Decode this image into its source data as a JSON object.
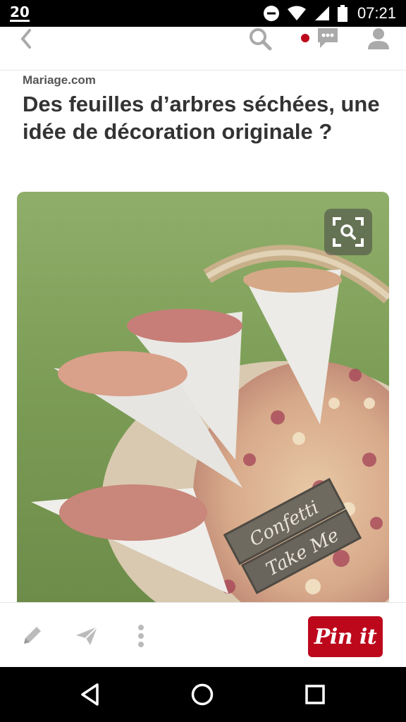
{
  "status_bar": {
    "time": "07:21",
    "logo_text": "20",
    "icons": [
      "app-logo-icon",
      "do-not-disturb-icon",
      "wifi-icon",
      "signal-icon",
      "battery-icon"
    ]
  },
  "header": {
    "icons": [
      "back-arrow-icon",
      "search-icon",
      "notification-dot-icon",
      "messages-icon",
      "profile-icon"
    ],
    "notification_color": "#bd081c"
  },
  "pin": {
    "source": "Mariage.com",
    "title": "Des feuilles d’arbres séchées, une idée de décoration originale ?",
    "sign_line_1": "Confetti",
    "sign_line_2": "Take Me"
  },
  "actions": {
    "icons": [
      "edit-pencil-icon",
      "send-icon",
      "more-vertical-icon"
    ],
    "pin_button_label": "Pin it",
    "accent": "#bd081c"
  },
  "nav": {
    "icons": [
      "back-triangle-icon",
      "home-circle-icon",
      "recents-square-icon"
    ]
  }
}
